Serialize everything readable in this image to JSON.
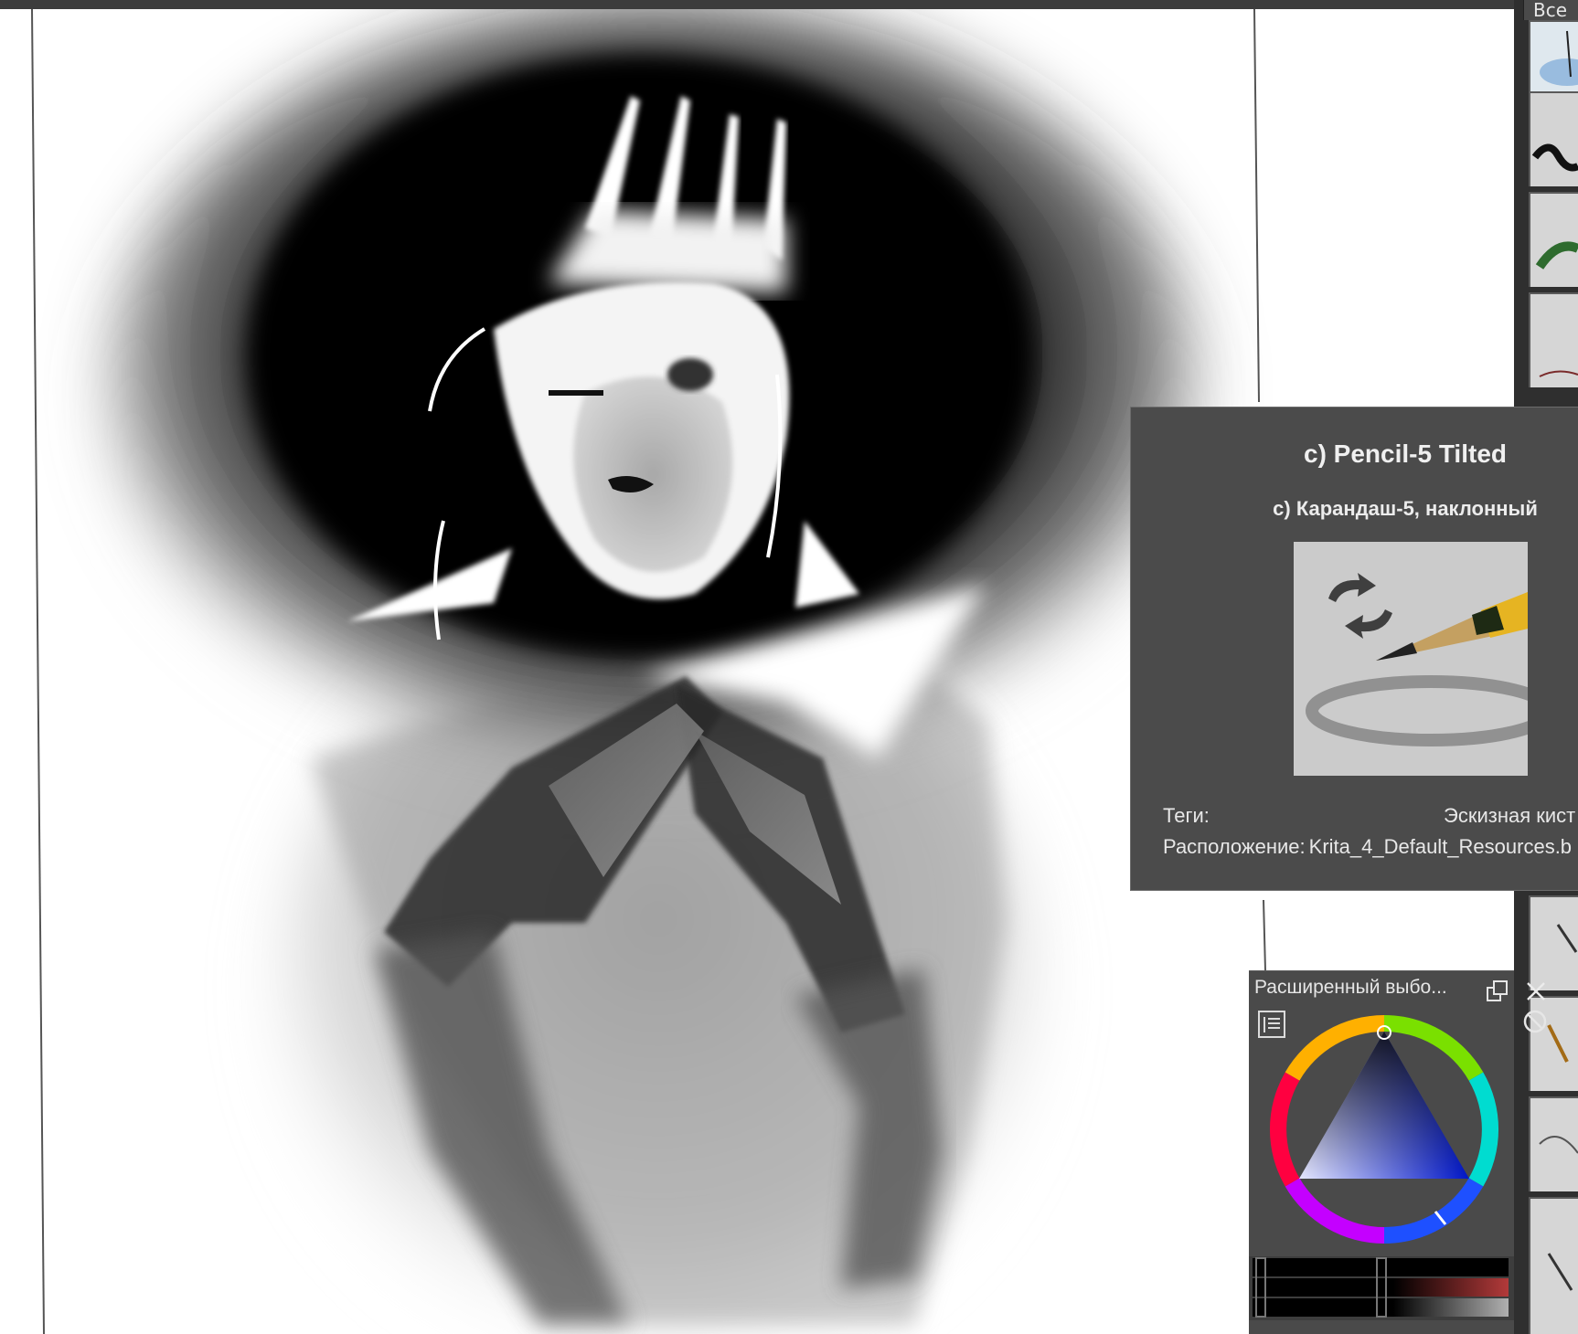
{
  "brush_tab": {
    "label": "Все"
  },
  "tooltip": {
    "title": "c) Pencil-5 Tilted",
    "subtitle": "c) Карандаш-5, наклонный",
    "tags_label": "Теги:",
    "tags_value": "Эскизная кист",
    "location_label": "Расположение:",
    "location_value": "Krita_4_Default_Resources.b"
  },
  "color_docker": {
    "title": "Расширенный выбо...",
    "selected_color": "#0a0f8a"
  },
  "icons": [
    "float-icon",
    "close-icon",
    "settings-icon",
    "reset-icon",
    "rotate-arrows-icon"
  ]
}
